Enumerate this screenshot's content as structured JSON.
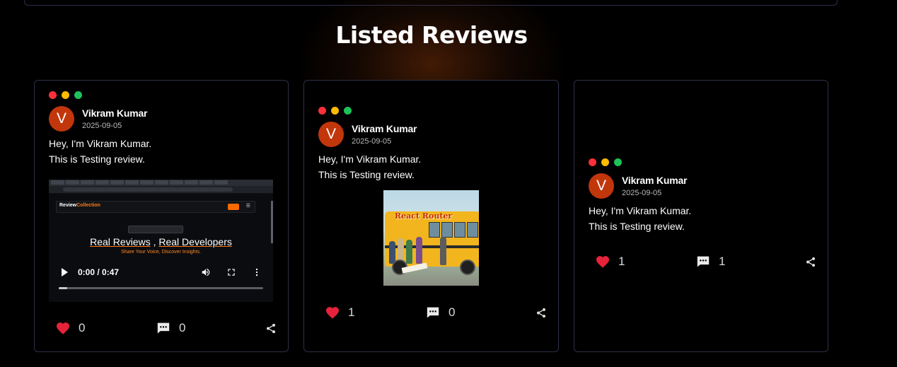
{
  "section": {
    "title": "Listed Reviews"
  },
  "reviews": [
    {
      "author_initial": "V",
      "author_name": "Vikram Kumar",
      "date": "2025-09-05",
      "text_line1": "Hey, I'm Vikram Kumar.",
      "text_line2": "This is Testing review.",
      "media": "video",
      "likes": "0",
      "comments": "0"
    },
    {
      "author_initial": "V",
      "author_name": "Vikram Kumar",
      "date": "2025-09-05",
      "text_line1": "Hey, I'm Vikram Kumar.",
      "text_line2": "This is Testing review.",
      "media": "image",
      "likes": "1",
      "comments": "0"
    },
    {
      "author_initial": "V",
      "author_name": "Vikram Kumar",
      "date": "2025-09-05",
      "text_line1": "Hey, I'm Vikram Kumar.",
      "text_line2": "This is Testing review.",
      "media": "none",
      "likes": "1",
      "comments": "1"
    }
  ],
  "video": {
    "time": "0:00 / 0:47",
    "heading_part1": "Real Reviews",
    "heading_sep": ",",
    "heading_part2": "Real Developers",
    "subheading": "Share Your Voice, Discover Insights.",
    "logo_text": "Review",
    "logo_accent": "Collection"
  },
  "image": {
    "title": "React Router"
  },
  "colors": {
    "background": "#000000",
    "card_border": "#2c3047",
    "avatar": "#c2360c",
    "heart": "#e8223a",
    "dot_red": "#ff2f3b",
    "dot_yellow": "#ffbb00",
    "dot_green": "#1ec25a"
  }
}
